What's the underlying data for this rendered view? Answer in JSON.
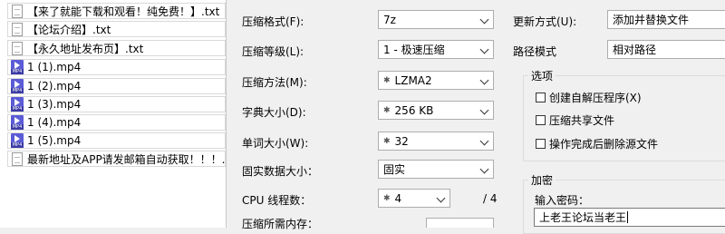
{
  "files": [
    {
      "name": "【来了就能下载和观看！纯免费！】.txt",
      "type": "txt"
    },
    {
      "name": "【论坛介绍】.txt",
      "type": "txt"
    },
    {
      "name": "【永久地址发布页】.txt",
      "type": "txt"
    },
    {
      "name": "1 (1).mp4",
      "type": "mp4"
    },
    {
      "name": "1 (2).mp4",
      "type": "mp4"
    },
    {
      "name": "1 (3).mp4",
      "type": "mp4"
    },
    {
      "name": "1 (4).mp4",
      "type": "mp4"
    },
    {
      "name": "1 (5).mp4",
      "type": "mp4"
    },
    {
      "name": "最新地址及APP请发邮箱自动获取！！！....",
      "type": "txt"
    }
  ],
  "settings": {
    "format_label": "压缩格式(F):",
    "format_value": "7z",
    "level_label": "压缩等级(L):",
    "level_value": "1 - 极速压缩",
    "method_label": "压缩方法(M):",
    "method_value": "LZMA2",
    "dict_label": "字典大小(D):",
    "dict_value": "256 KB",
    "word_label": "单词大小(W):",
    "word_value": "32",
    "solid_label": "固实数据大小：",
    "solid_value": "固实",
    "threads_label": "CPU 线程数：",
    "threads_value": "4",
    "threads_total": "/ 4",
    "memory_label": "压缩所需内存："
  },
  "update": {
    "mode_label": "更新方式(U):",
    "mode_value": "添加并替换文件",
    "path_label": "路径模式",
    "path_value": "相对路径"
  },
  "options": {
    "title": "选项",
    "sfx": "创建自解压程序(X)",
    "shared": "压缩共享文件",
    "delete": "操作完成后删除源文件"
  },
  "encryption": {
    "title": "加密",
    "password_label": "输入密码：",
    "password_value": "上老王论坛当老王"
  }
}
